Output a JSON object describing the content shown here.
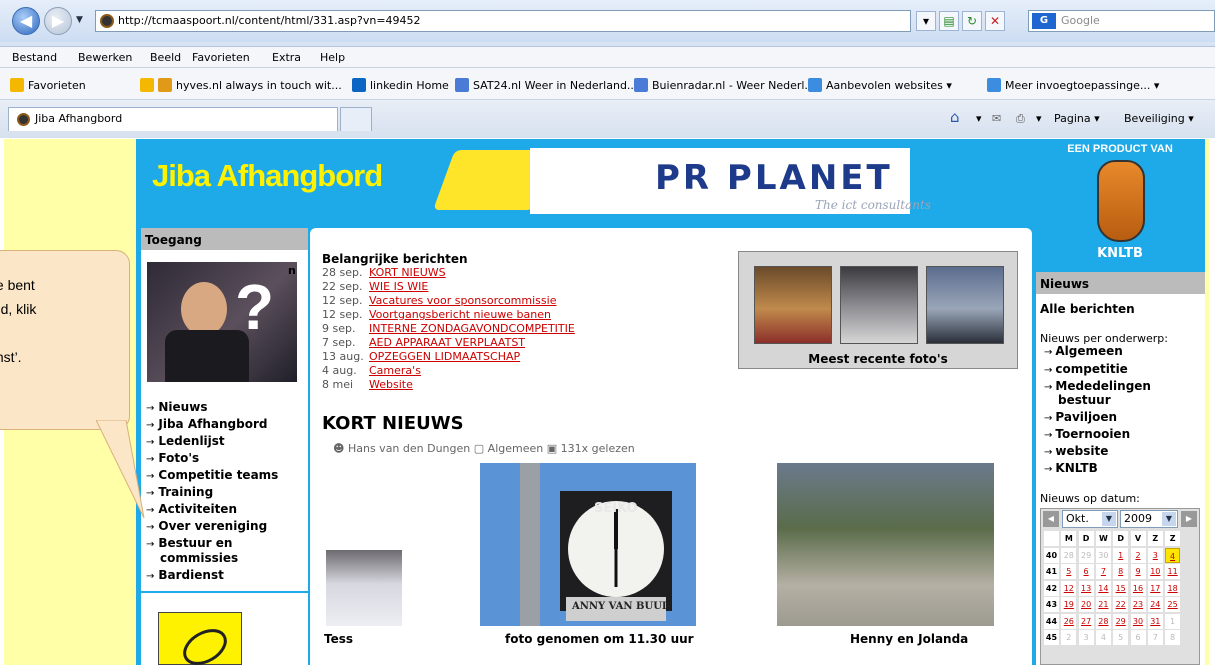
{
  "browser": {
    "url": "http://tcmaaspoort.nl/content/html/331.asp?vn=49452",
    "search_placeholder": "Google",
    "menu": [
      "Bestand",
      "Bewerken",
      "Beeld",
      "Favorieten",
      "Extra",
      "Help"
    ],
    "favorites_label": "Favorieten",
    "favorites": [
      "hyves.nl always in touch wit...",
      "linkedin Home",
      "SAT24.nl Weer in Nederland...",
      "Buienradar.nl - Weer Nederl...",
      "Aanbevolen websites",
      "Meer invoegtoepassinge..."
    ],
    "tab_title": "Jiba Afhangbord",
    "commands": {
      "page": "Pagina",
      "security": "Beveiliging"
    }
  },
  "header": {
    "logo": "Jiba Afhangbord",
    "sponsor": "PR PLANET",
    "sponsor_tagline": "The ict consultants",
    "product_caption": "EEN PRODUCT VAN",
    "knltb": "KNLTB"
  },
  "nav": {
    "title": "Toegang",
    "peek_text": "n",
    "links": [
      "Nieuws",
      "Jiba Afhangbord",
      "Ledenlijst",
      "Foto's",
      "Competitie teams",
      "Training",
      "Activiteiten",
      "Over vereniging",
      "Bestuur en",
      "commissies",
      "Bardienst"
    ]
  },
  "main": {
    "messages_title": "Belangrijke berichten",
    "messages": [
      {
        "date": "28 sep.",
        "title": "KORT NIEUWS"
      },
      {
        "date": "22 sep.",
        "title": "WIE IS WIE"
      },
      {
        "date": "12 sep.",
        "title": "Vacatures voor sponsorcommissie"
      },
      {
        "date": "12 sep.",
        "title": "Voortgangsbericht nieuwe banen"
      },
      {
        "date": "9 sep.",
        "title": "INTERNE ZONDAGAVONDCOMPETITIE"
      },
      {
        "date": "7 sep.",
        "title": "AED APPARAAT VERPLAATST"
      },
      {
        "date": "13 aug.",
        "title": "OPZEGGEN LIDMAATSCHAP"
      },
      {
        "date": "4 aug.",
        "title": "Camera's"
      },
      {
        "date": "8 mei",
        "title": "Website"
      }
    ],
    "photos_caption": "Meest recente foto's",
    "article_title": "KORT NIEUWS",
    "article_author": "Hans van den Dungen",
    "article_category": "Algemeen",
    "article_reads": "131x gelezen",
    "captions": [
      "Tess",
      "foto genomen om 11.30 uur",
      "Henny en Jolanda"
    ],
    "clock_brand": "SEIKO",
    "clock_sign": "ANNY VAN BUUL"
  },
  "news": {
    "title": "Nieuws",
    "all": "Alle berichten",
    "per_topic": "Nieuws per onderwerp:",
    "topics": [
      "Algemeen",
      "competitie",
      "Mededelingen",
      "bestuur",
      "Paviljoen",
      "Toernooien",
      "website",
      "KNLTB"
    ],
    "by_date": "Nieuws op datum:",
    "month": "Okt.",
    "year": "2009",
    "weekdays": [
      "M",
      "D",
      "W",
      "D",
      "V",
      "Z",
      "Z"
    ],
    "weeks": [
      {
        "wk": "40",
        "days": [
          "28",
          "29",
          "30",
          "1",
          "2",
          "3",
          "4"
        ]
      },
      {
        "wk": "41",
        "days": [
          "5",
          "6",
          "7",
          "8",
          "9",
          "10",
          "11"
        ]
      },
      {
        "wk": "42",
        "days": [
          "12",
          "13",
          "14",
          "15",
          "16",
          "17",
          "18"
        ]
      },
      {
        "wk": "43",
        "days": [
          "19",
          "20",
          "21",
          "22",
          "23",
          "24",
          "25"
        ]
      },
      {
        "wk": "44",
        "days": [
          "26",
          "27",
          "28",
          "29",
          "30",
          "31",
          "1"
        ]
      },
      {
        "wk": "45",
        "days": [
          "2",
          "3",
          "4",
          "5",
          "6",
          "7",
          "8"
        ]
      }
    ]
  },
  "callout": {
    "lines": [
      "t je bent",
      "ogd, klik",
      "",
      "ienst’."
    ]
  }
}
